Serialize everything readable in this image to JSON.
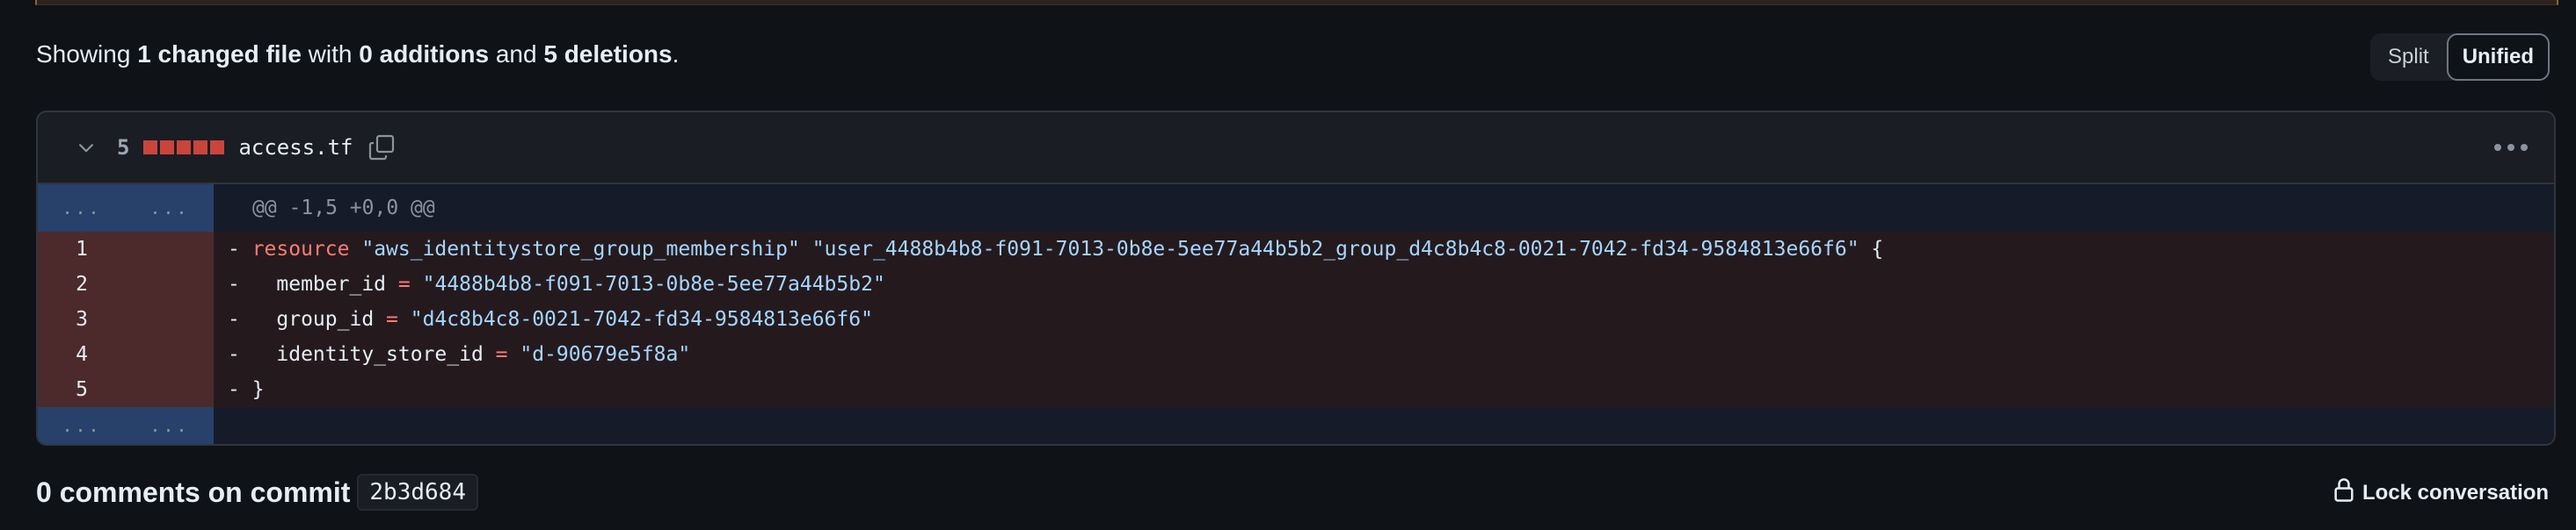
{
  "summary": {
    "prefix": "Showing ",
    "changed_files": "1 changed file",
    "mid1": " with ",
    "additions": "0 additions",
    "mid2": " and ",
    "deletions": "5 deletions",
    "suffix": "."
  },
  "view_toggle": {
    "split_label": "Split",
    "unified_label": "Unified",
    "selected": "Unified"
  },
  "file": {
    "change_count": "5",
    "deleted_blocks": 5,
    "name": "access.tf",
    "icons": {
      "collapse": "chevron-down-icon",
      "copy": "copy-icon",
      "more": "kebab-horizontal-icon"
    }
  },
  "diff": {
    "hunk_header": "@@ -1,5 +0,0 @@",
    "expander_text": "...",
    "lines": [
      {
        "num": "1",
        "sign": "- ",
        "parts": [
          {
            "t": "kw",
            "v": "resource"
          },
          {
            "t": "plain",
            "v": " "
          },
          {
            "t": "str",
            "v": "\"aws_identitystore_group_membership\""
          },
          {
            "t": "plain",
            "v": " "
          },
          {
            "t": "str",
            "v": "\"user_4488b4b8-f091-7013-0b8e-5ee77a44b5b2_group_d4c8b4c8-0021-7042-fd34-9584813e66f6\""
          },
          {
            "t": "plain",
            "v": " {"
          }
        ]
      },
      {
        "num": "2",
        "sign": "-   ",
        "parts": [
          {
            "t": "plain",
            "v": "member_id "
          },
          {
            "t": "op",
            "v": "="
          },
          {
            "t": "plain",
            "v": " "
          },
          {
            "t": "str",
            "v": "\"4488b4b8-f091-7013-0b8e-5ee77a44b5b2\""
          }
        ]
      },
      {
        "num": "3",
        "sign": "-   ",
        "parts": [
          {
            "t": "plain",
            "v": "group_id "
          },
          {
            "t": "op",
            "v": "="
          },
          {
            "t": "plain",
            "v": " "
          },
          {
            "t": "str",
            "v": "\"d4c8b4c8-0021-7042-fd34-9584813e66f6\""
          }
        ]
      },
      {
        "num": "4",
        "sign": "-   ",
        "parts": [
          {
            "t": "plain",
            "v": "identity_store_id "
          },
          {
            "t": "op",
            "v": "="
          },
          {
            "t": "plain",
            "v": " "
          },
          {
            "t": "str",
            "v": "\"d-90679e5f8a\""
          }
        ]
      },
      {
        "num": "5",
        "sign": "- ",
        "parts": [
          {
            "t": "plain",
            "v": "}"
          }
        ]
      }
    ]
  },
  "comments": {
    "title": "0 comments on commit",
    "sha": "2b3d684"
  },
  "lock": {
    "label": "Lock conversation",
    "icon": "lock-icon"
  },
  "colors": {
    "deletion_block": "#c9453c",
    "keyword": "#ff7b72",
    "string": "#a5d6ff",
    "deleted_gutter": "#4c2a2b",
    "deleted_code": "#241a1e",
    "hunk_gutter": "#27416b"
  }
}
